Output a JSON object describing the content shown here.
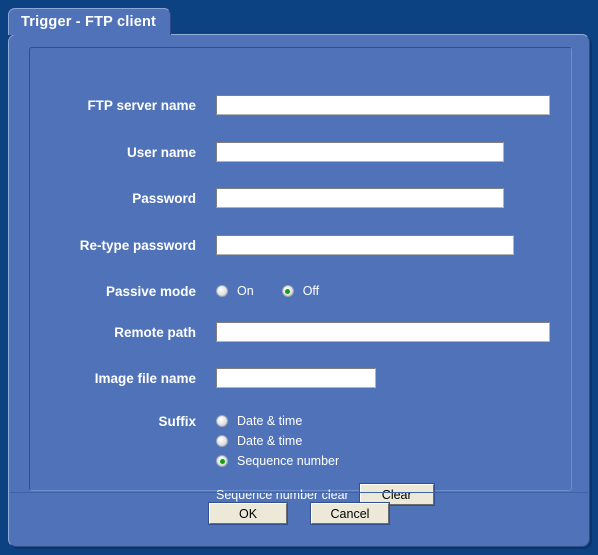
{
  "window": {
    "title": "Trigger - FTP client"
  },
  "colors": {
    "background": "#0d4282",
    "panel": "#4f72b8",
    "panel_border": "#93abd8",
    "label_text": "#ffffff",
    "input_background": "#ffffff",
    "button_face": "#ece9d8",
    "radio_selected": "#13a013"
  },
  "form": {
    "fields": [
      {
        "label": "FTP server name",
        "value": "",
        "placeholder": ""
      },
      {
        "label": "User name",
        "value": "",
        "placeholder": ""
      },
      {
        "label": "Password",
        "value": "",
        "placeholder": ""
      },
      {
        "label": "Re-type password",
        "value": "",
        "placeholder": ""
      },
      {
        "label": "Remote path",
        "value": "",
        "placeholder": ""
      },
      {
        "label": "Image file name",
        "value": "",
        "placeholder": ""
      }
    ],
    "passive_mode": {
      "label": "Passive mode",
      "options": [
        {
          "label": "On",
          "selected": false
        },
        {
          "label": "Off",
          "selected": true
        }
      ]
    },
    "suffix": {
      "label": "Suffix",
      "options": [
        {
          "label": "Date & time",
          "selected": false
        },
        {
          "label": "Date & time",
          "selected": false
        },
        {
          "label": "Sequence number",
          "selected": true
        }
      ],
      "clear_label": "Sequence number clear",
      "clear_button": "Clear"
    }
  },
  "footer": {
    "ok_label": "OK",
    "cancel_label": "Cancel"
  }
}
